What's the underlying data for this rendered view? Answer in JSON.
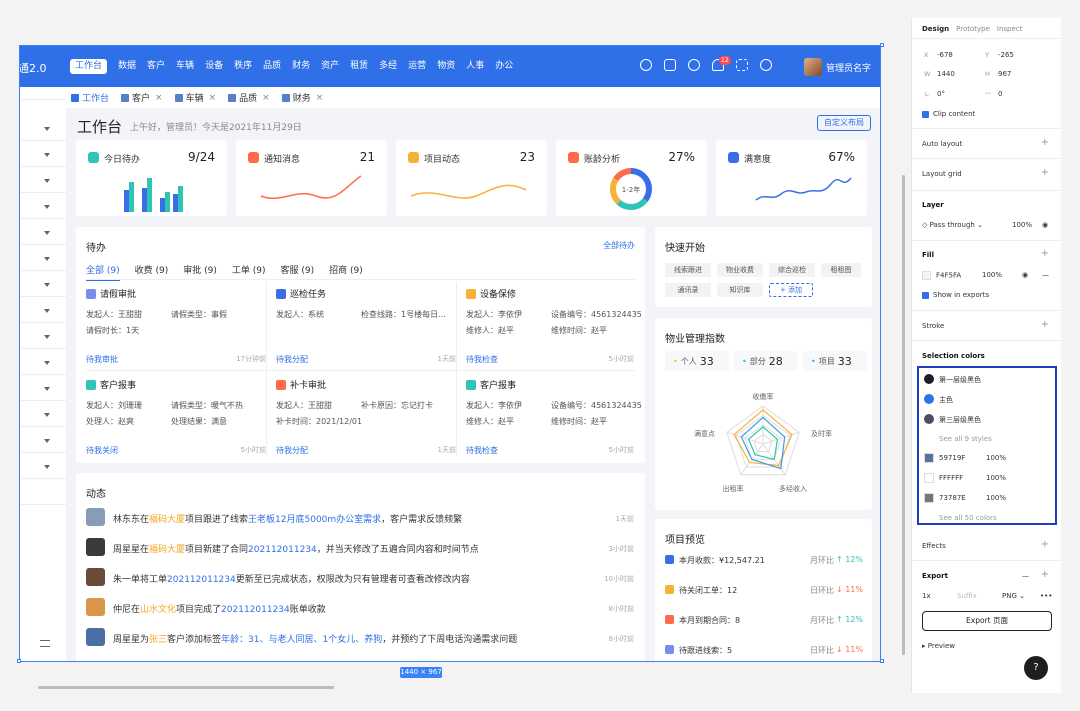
{
  "nav": {
    "logo": "通2.0",
    "menu": [
      "工作台",
      "数据",
      "客户",
      "车辆",
      "设备",
      "秩序",
      "品质",
      "财务",
      "资产",
      "租赁",
      "多经",
      "运营",
      "物资",
      "人事",
      "办公"
    ],
    "badge": "12",
    "user": "管理员名字"
  },
  "tabs": [
    {
      "label": "工作台"
    },
    {
      "label": "客户"
    },
    {
      "label": "车辆"
    },
    {
      "label": "品质"
    },
    {
      "label": "财务"
    }
  ],
  "page": {
    "title": "工作台",
    "greeting": "上午好，管理员！今天是2021年11月29日",
    "custom_btn": "自定义布局"
  },
  "stats": [
    {
      "label": "今日待办",
      "value": "9/24",
      "color": "#2ec4b6"
    },
    {
      "label": "通知消息",
      "value": "21",
      "color": "#ff6b4a"
    },
    {
      "label": "项目动态",
      "value": "23",
      "color": "#f5b335"
    },
    {
      "label": "账龄分析",
      "value": "27%",
      "color": "#ff6b4a",
      "ring": "1-2年"
    },
    {
      "label": "满意度",
      "value": "67%",
      "color": "#3a6ee8"
    }
  ],
  "todo": {
    "title": "待办",
    "all_link": "全部待办",
    "tabs": [
      "全部 (9)",
      "收费 (9)",
      "审批 (9)",
      "工单 (9)",
      "客服 (9)",
      "招商 (9)"
    ],
    "tasks": [
      {
        "title": "请假审批",
        "color": "#7b8cf0",
        "f1": "发起人：王甜甜",
        "f2": "请假类型：事假",
        "f3": "请假时长：1天",
        "f4": "",
        "action": "待我审批",
        "time": "17分钟前"
      },
      {
        "title": "巡检任务",
        "color": "#3a6ee8",
        "f1": "发起人：系统",
        "f2": "检查线路：1号楼每日...",
        "f3": "",
        "f4": "",
        "action": "待我分配",
        "time": "1天前"
      },
      {
        "title": "设备保修",
        "color": "#f5b335",
        "f1": "发起人：李依伊",
        "f2": "设备编号：4561324435",
        "f3": "维修人：赵平",
        "f4": "维修时间：赵平",
        "action": "待我检查",
        "time": "5小时前"
      },
      {
        "title": "客户报事",
        "color": "#2ec4b6",
        "f1": "发起人：刘珊珊",
        "f2": "请假类型：暖气不热",
        "f3": "处理人：赵爽",
        "f4": "处理结果：满意",
        "action": "待我关闭",
        "time": "5小时前"
      },
      {
        "title": "补卡审批",
        "color": "#ff6b4a",
        "f1": "发起人：王甜甜",
        "f2": "补卡原因：忘记打卡",
        "f3": "补卡时间：2021/12/01",
        "f4": "",
        "action": "待我分配",
        "time": "1天前"
      },
      {
        "title": "客户报事",
        "color": "#2ec4b6",
        "f1": "发起人：李依伊",
        "f2": "设备编号：4561324435",
        "f3": "维修人：赵平",
        "f4": "维修时间：赵平",
        "action": "待我检查",
        "time": "5小时前"
      }
    ]
  },
  "quick": {
    "title": "快速开始",
    "items": [
      "线索跟进",
      "物业收费",
      "综合巡检",
      "租租图",
      "通讯录",
      "知识库"
    ],
    "add": "+ 添加"
  },
  "index": {
    "title": "物业管理指数",
    "chips": [
      {
        "label": "个人",
        "value": "33",
        "color": "#f5b335"
      },
      {
        "label": "部分",
        "value": "28",
        "color": "#2ec4b6"
      },
      {
        "label": "项目",
        "value": "33",
        "color": "#3a9ee8"
      }
    ],
    "axes": [
      "收缴率",
      "及时率",
      "多经收入",
      "出租率",
      "满意点"
    ]
  },
  "dynamic": {
    "title": "动态",
    "items": [
      {
        "pre": "林东东在",
        "hl": "福码大厦",
        "mid": "项目跟进了线索",
        "bl": "王老板12月底5000m办公室需求",
        "post": "，客户需求反馈频繁",
        "time": "1天前",
        "av": "#8a9bb8"
      },
      {
        "pre": "周星星在",
        "hl": "福码大厦",
        "mid": "项目新建了合同",
        "bl": "202112011234",
        "post": "，并当天修改了五遍合同内容和时间节点",
        "time": "3小时前",
        "av": "#3b3b3b"
      },
      {
        "pre": "朱一单将工单",
        "hl": "",
        "mid": "",
        "bl": "202112011234",
        "post": "更新至已完成状态，权限改为只有管理者可查看改修改内容",
        "time": "10小时前",
        "av": "#6b4a3a"
      },
      {
        "pre": "仲尼在",
        "hl": "山水文化",
        "mid": "项目完成了",
        "bl": "202112011234",
        "post": "账单收款",
        "time": "8小时前",
        "av": "#d9964a"
      },
      {
        "pre": "周星星为",
        "hl": "张三",
        "mid": "客户添加标签",
        "bl": "年龄：31、与老人同居、1个女儿、养狗",
        "post": "，并预约了下周电话沟通需求问题",
        "time": "8小时前",
        "av": "#4a6fa5"
      }
    ]
  },
  "preview": {
    "title": "项目预览",
    "items": [
      {
        "label": "本月收款：¥12,547.21",
        "cmp": "月环比",
        "pct": "↑ 12%",
        "color": "#3a6ee8"
      },
      {
        "label": "待关闭工单：12",
        "cmp": "日环比",
        "pct": "↓ 11%",
        "color": "#f5b335"
      },
      {
        "label": "本月到期合同：8",
        "cmp": "月环比",
        "pct": "↑ 12%",
        "color": "#ff6b4a"
      },
      {
        "label": "待跟进线索：5",
        "cmp": "日环比",
        "pct": "↓ 11%",
        "color": "#7b8cf0"
      }
    ]
  },
  "dims": "1440 × 967",
  "panel": {
    "tabs": [
      "Design",
      "Prototype",
      "Inspect"
    ],
    "x_lbl": "X",
    "x": "-678",
    "y_lbl": "Y",
    "y": "-265",
    "w_lbl": "W",
    "w": "1440",
    "h_lbl": "H",
    "h": "967",
    "rot": "0°",
    "rad": "0",
    "clip": "Clip content",
    "auto_layout": "Auto layout",
    "layout_grid": "Layout grid",
    "layer": "Layer",
    "pass": "Pass through",
    "pass_pct": "100%",
    "fill": "Fill",
    "fill_hex": "F4F5FA",
    "fill_pct": "100%",
    "show_exports": "Show in exports",
    "stroke": "Stroke",
    "sel_colors": "Selection colors",
    "styles": [
      {
        "name": "第一层级黑色",
        "color": "#1e1e2a"
      },
      {
        "name": "主色",
        "color": "#2f6fe8"
      },
      {
        "name": "第三层级黑色",
        "color": "#4a5060"
      }
    ],
    "see_styles": "See all 9 styles",
    "colors": [
      {
        "hex": "59719F",
        "pct": "100%",
        "color": "#59719F"
      },
      {
        "hex": "FFFFFF",
        "pct": "100%",
        "color": "#FFFFFF"
      },
      {
        "hex": "73787E",
        "pct": "100%",
        "color": "#73787E"
      }
    ],
    "see_colors": "See all 50 colors",
    "effects": "Effects",
    "export": "Export",
    "scale": "1x",
    "suffix": "Suffix",
    "format": "PNG",
    "export_btn": "Export 页面",
    "preview": "Preview",
    "help": "?"
  }
}
